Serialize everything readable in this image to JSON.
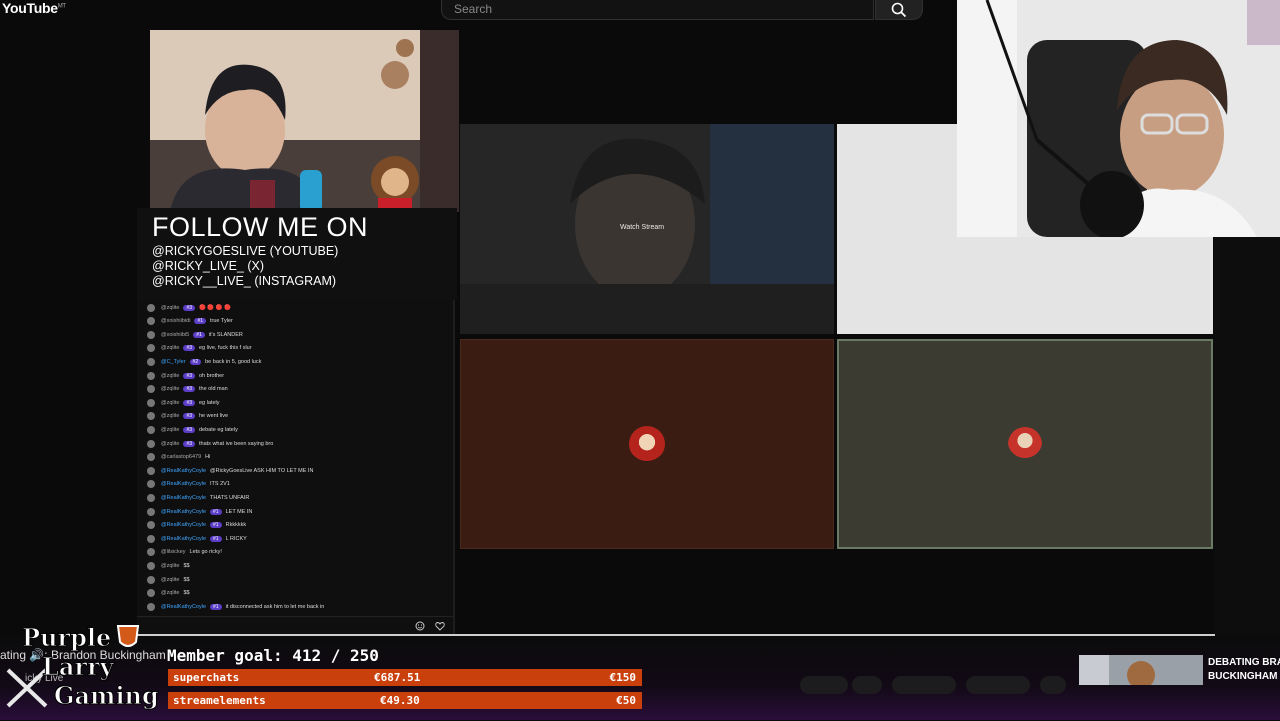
{
  "youtube": {
    "logo_text": "YouTube",
    "logo_sup": "MT",
    "search_placeholder": "Search"
  },
  "follow": {
    "title": "FOLLOW ME ON",
    "lines": [
      "@RICKYGOESLIVE (YOUTUBE)",
      "@RICKY_LIVE_ (X)",
      "@RICKY__LIVE_ (INSTAGRAM)"
    ]
  },
  "chat": [
    {
      "name": "@zqlite",
      "badge": "#3",
      "msg": "🔴 🔴 🔴 🔴",
      "blue": false
    },
    {
      "name": "@xoishiibidi",
      "badge": "#1",
      "msg": "true Tyler",
      "blue": false
    },
    {
      "name": "@xoishiibi5",
      "badge": "#1",
      "msg": "it's SLANDER",
      "blue": false
    },
    {
      "name": "@zqlite",
      "badge": "#3",
      "msg": "eg live, fuck this f slur",
      "blue": false
    },
    {
      "name": "@C_Tyler",
      "badge": "#2",
      "msg": "be back in 5, good luck",
      "blue": true
    },
    {
      "name": "@zqlite",
      "badge": "#3",
      "msg": "oh brother",
      "blue": false
    },
    {
      "name": "@zqlite",
      "badge": "#3",
      "msg": "the old man",
      "blue": false
    },
    {
      "name": "@zqlite",
      "badge": "#3",
      "msg": "eg lately",
      "blue": false
    },
    {
      "name": "@zqlite",
      "badge": "#3",
      "msg": "he went live",
      "blue": false
    },
    {
      "name": "@zqlite",
      "badge": "#3",
      "msg": "debate eg lately",
      "blue": false
    },
    {
      "name": "@zqlite",
      "badge": "#3",
      "msg": "thats what ive been saying bro",
      "blue": false
    },
    {
      "name": "@carlastop6479",
      "badge": "",
      "msg": "Hi",
      "blue": false
    },
    {
      "name": "@RealKathyCoyle",
      "badge": "",
      "msg": "@RickyGoesLive ASK HIM TO LET ME IN",
      "blue": true
    },
    {
      "name": "@RealKathyCoyle",
      "badge": "",
      "msg": "ITS 2V1",
      "blue": true
    },
    {
      "name": "@RealKathyCoyle",
      "badge": "",
      "msg": "THATS UNFAIR",
      "blue": true
    },
    {
      "name": "@RealKathyCoyle",
      "badge": "#1",
      "msg": "LET ME IN",
      "blue": true
    },
    {
      "name": "@RealKathyCoyle",
      "badge": "#1",
      "msg": "Rkkkkkk",
      "blue": true
    },
    {
      "name": "@RealKathyCoyle",
      "badge": "#1",
      "msg": "L RICKY",
      "blue": true
    },
    {
      "name": "@lilsickey",
      "badge": "",
      "msg": "Lets go ricky!",
      "blue": false
    },
    {
      "name": "@zqlite",
      "badge": "",
      "msg": "$$",
      "blue": false
    },
    {
      "name": "@zqlite",
      "badge": "",
      "msg": "$$",
      "blue": false
    },
    {
      "name": "@zqlite",
      "badge": "",
      "msg": "$$",
      "blue": false
    },
    {
      "name": "@RealKathyCoyle",
      "badge": "#1",
      "msg": "it disconnected ask him to let me back in",
      "blue": true
    }
  ],
  "grid": {
    "watch_stream_label": "Watch Stream"
  },
  "goal": {
    "label": "Member goal: 412 / 250",
    "bars": [
      {
        "name": "superchats",
        "amount": "€687.51",
        "target": "€150"
      },
      {
        "name": "streamelements",
        "amount": "€49.30",
        "target": "€50"
      }
    ]
  },
  "bottom": {
    "overlap_text": "ating 🔊: Brandon Buckingham",
    "overlap_text2": "icky Live",
    "logo_lines": [
      "Purple",
      "Larry",
      "Gaming"
    ],
    "next_title_line1": "DEBATING BRA",
    "next_title_line2": "BUCKINGHAM C"
  },
  "colors": {
    "goal_bar": "#c9400c",
    "tile_brown": "#3a1c12",
    "tile_olive": "#3b3b31",
    "badge_purple": "#5b3dc7"
  }
}
